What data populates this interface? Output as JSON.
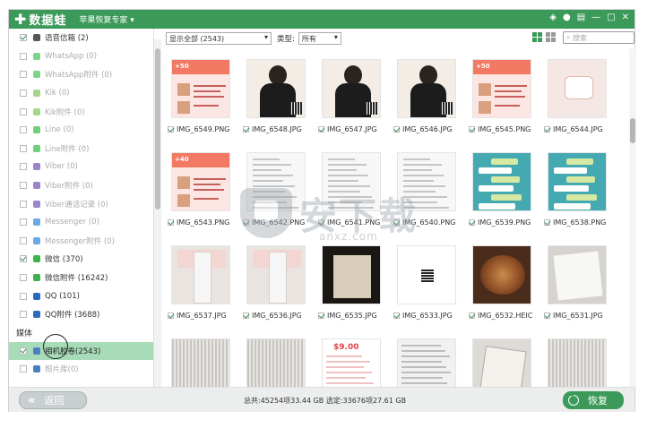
{
  "app": {
    "brand": "数据蛙",
    "product": "苹果恢复专家"
  },
  "sidebar": {
    "items": [
      {
        "label": "语音信箱 (2)",
        "checked": true,
        "enabled": true,
        "icon": "voicemail-icon",
        "color": "#555555"
      },
      {
        "label": "WhatsApp (0)",
        "checked": false,
        "enabled": false,
        "icon": "whatsapp-icon",
        "color": "#7ed38a"
      },
      {
        "label": "WhatsApp附件 (0)",
        "checked": false,
        "enabled": false,
        "icon": "whatsapp-icon",
        "color": "#7ed38a"
      },
      {
        "label": "Kik (0)",
        "checked": false,
        "enabled": false,
        "icon": "kik-icon",
        "color": "#a8d48c"
      },
      {
        "label": "Kik附件 (0)",
        "checked": false,
        "enabled": false,
        "icon": "kik-icon",
        "color": "#a8d48c"
      },
      {
        "label": "Line (0)",
        "checked": false,
        "enabled": false,
        "icon": "line-icon",
        "color": "#6fcf7a"
      },
      {
        "label": "Line附件 (0)",
        "checked": false,
        "enabled": false,
        "icon": "line-icon",
        "color": "#6fcf7a"
      },
      {
        "label": "Viber (0)",
        "checked": false,
        "enabled": false,
        "icon": "viber-icon",
        "color": "#9b84c8"
      },
      {
        "label": "Viber附件 (0)",
        "checked": false,
        "enabled": false,
        "icon": "viber-icon",
        "color": "#9b84c8"
      },
      {
        "label": "Viber通话记录 (0)",
        "checked": false,
        "enabled": false,
        "icon": "viber-icon",
        "color": "#9b84c8"
      },
      {
        "label": "Messenger (0)",
        "checked": false,
        "enabled": false,
        "icon": "messenger-icon",
        "color": "#6aa8e8"
      },
      {
        "label": "Messenger附件 (0)",
        "checked": false,
        "enabled": false,
        "icon": "messenger-icon",
        "color": "#6aa8e8"
      },
      {
        "label": "微信 (370)",
        "checked": true,
        "enabled": true,
        "icon": "wechat-icon",
        "color": "#3bb34a"
      },
      {
        "label": "微信附件 (16242)",
        "checked": false,
        "enabled": true,
        "icon": "wechat-icon",
        "color": "#3bb34a"
      },
      {
        "label": "QQ (101)",
        "checked": false,
        "enabled": true,
        "icon": "qq-icon",
        "color": "#2b6bbd"
      },
      {
        "label": "QQ附件 (3688)",
        "checked": false,
        "enabled": true,
        "icon": "qq-icon",
        "color": "#2b6bbd"
      }
    ],
    "section_media": "媒体",
    "media_items": [
      {
        "label": "相机胶卷(2543)",
        "checked": true,
        "enabled": true,
        "selected": true,
        "icon": "camera-roll-icon",
        "color": "#4a7fbf"
      },
      {
        "label": "照片库(0)",
        "checked": false,
        "enabled": false,
        "selected": false,
        "icon": "photo-library-icon",
        "color": "#4a7fbf"
      }
    ]
  },
  "toolbar": {
    "filter_value": "显示全部 (2543)",
    "type_label": "类型:",
    "type_value": "所有",
    "search_placeholder": "搜索"
  },
  "photos": [
    {
      "name": "IMG_6549.PNG",
      "kind": "promo",
      "badge": "+50"
    },
    {
      "name": "IMG_6548.JPG",
      "kind": "person"
    },
    {
      "name": "IMG_6547.JPG",
      "kind": "person"
    },
    {
      "name": "IMG_6546.JPG",
      "kind": "person"
    },
    {
      "name": "IMG_6545.PNG",
      "kind": "promo",
      "badge": "+50"
    },
    {
      "name": "IMG_6544.JPG",
      "kind": "cooker"
    },
    {
      "name": "IMG_6543.PNG",
      "kind": "promo",
      "badge": "+40"
    },
    {
      "name": "IMG_6542.PNG",
      "kind": "chat"
    },
    {
      "name": "IMG_6541.PNG",
      "kind": "chat"
    },
    {
      "name": "IMG_6540.PNG",
      "kind": "chat"
    },
    {
      "name": "IMG_6539.PNG",
      "kind": "chat2"
    },
    {
      "name": "IMG_6538.PNG",
      "kind": "chat2"
    },
    {
      "name": "IMG_6537.JPG",
      "kind": "bottle"
    },
    {
      "name": "IMG_6536.JPG",
      "kind": "bottle"
    },
    {
      "name": "IMG_6535.JPG",
      "kind": "kerastase"
    },
    {
      "name": "IMG_6533.JPG",
      "kind": "blank"
    },
    {
      "name": "IMG_6532.HEIC",
      "kind": "food"
    },
    {
      "name": "IMG_6531.JPG",
      "kind": "papers"
    },
    {
      "name": "",
      "kind": "scan"
    },
    {
      "name": "",
      "kind": "scan"
    },
    {
      "name": "",
      "kind": "price",
      "badge": "$9.00"
    },
    {
      "name": "",
      "kind": "sheet"
    },
    {
      "name": "",
      "kind": "book"
    },
    {
      "name": "",
      "kind": "scan"
    }
  ],
  "watermark": {
    "big": "安下载",
    "small": "anxz.com"
  },
  "footer": {
    "back_label": "返回",
    "stats": "总共:45254项33.44 GB 选定:33676项27.61 GB",
    "recover_label": "恢复"
  }
}
